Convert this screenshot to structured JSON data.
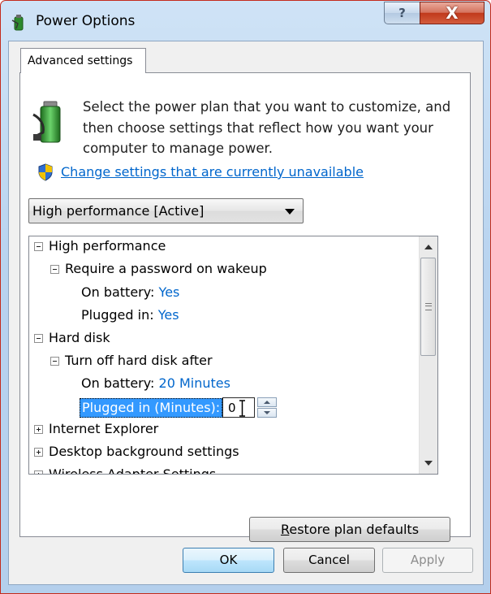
{
  "window": {
    "title": "Power Options",
    "help_label": "?",
    "close_label": "X"
  },
  "tab": {
    "label": "Advanced settings"
  },
  "description": "Select the power plan that you want to customize, and then choose settings that reflect how you want your computer to manage power.",
  "change_link": "Change settings that are currently unavailable",
  "plan_select": {
    "selected": "High performance [Active]"
  },
  "tree": {
    "high_performance": "High performance",
    "require_password": "Require a password on wakeup",
    "on_battery_label": "On battery:",
    "on_battery_value": "Yes",
    "plugged_in_label": "Plugged in:",
    "plugged_in_value": "Yes",
    "hard_disk": "Hard disk",
    "turn_off_disk": "Turn off hard disk after",
    "disk_battery_label": "On battery:",
    "disk_battery_value": "20 Minutes",
    "disk_plugged_label": "Plugged in (Minutes):",
    "disk_plugged_value": "0",
    "internet_explorer": "Internet Explorer",
    "desktop_background": "Desktop background settings",
    "wireless_adapter": "Wireless Adapter Settings"
  },
  "buttons": {
    "restore_prefix": "R",
    "restore_rest": "estore plan defaults",
    "ok": "OK",
    "cancel": "Cancel",
    "apply": "Apply"
  },
  "colors": {
    "link": "#0066cc",
    "selection": "#3399ff",
    "close": "#c0391b"
  }
}
